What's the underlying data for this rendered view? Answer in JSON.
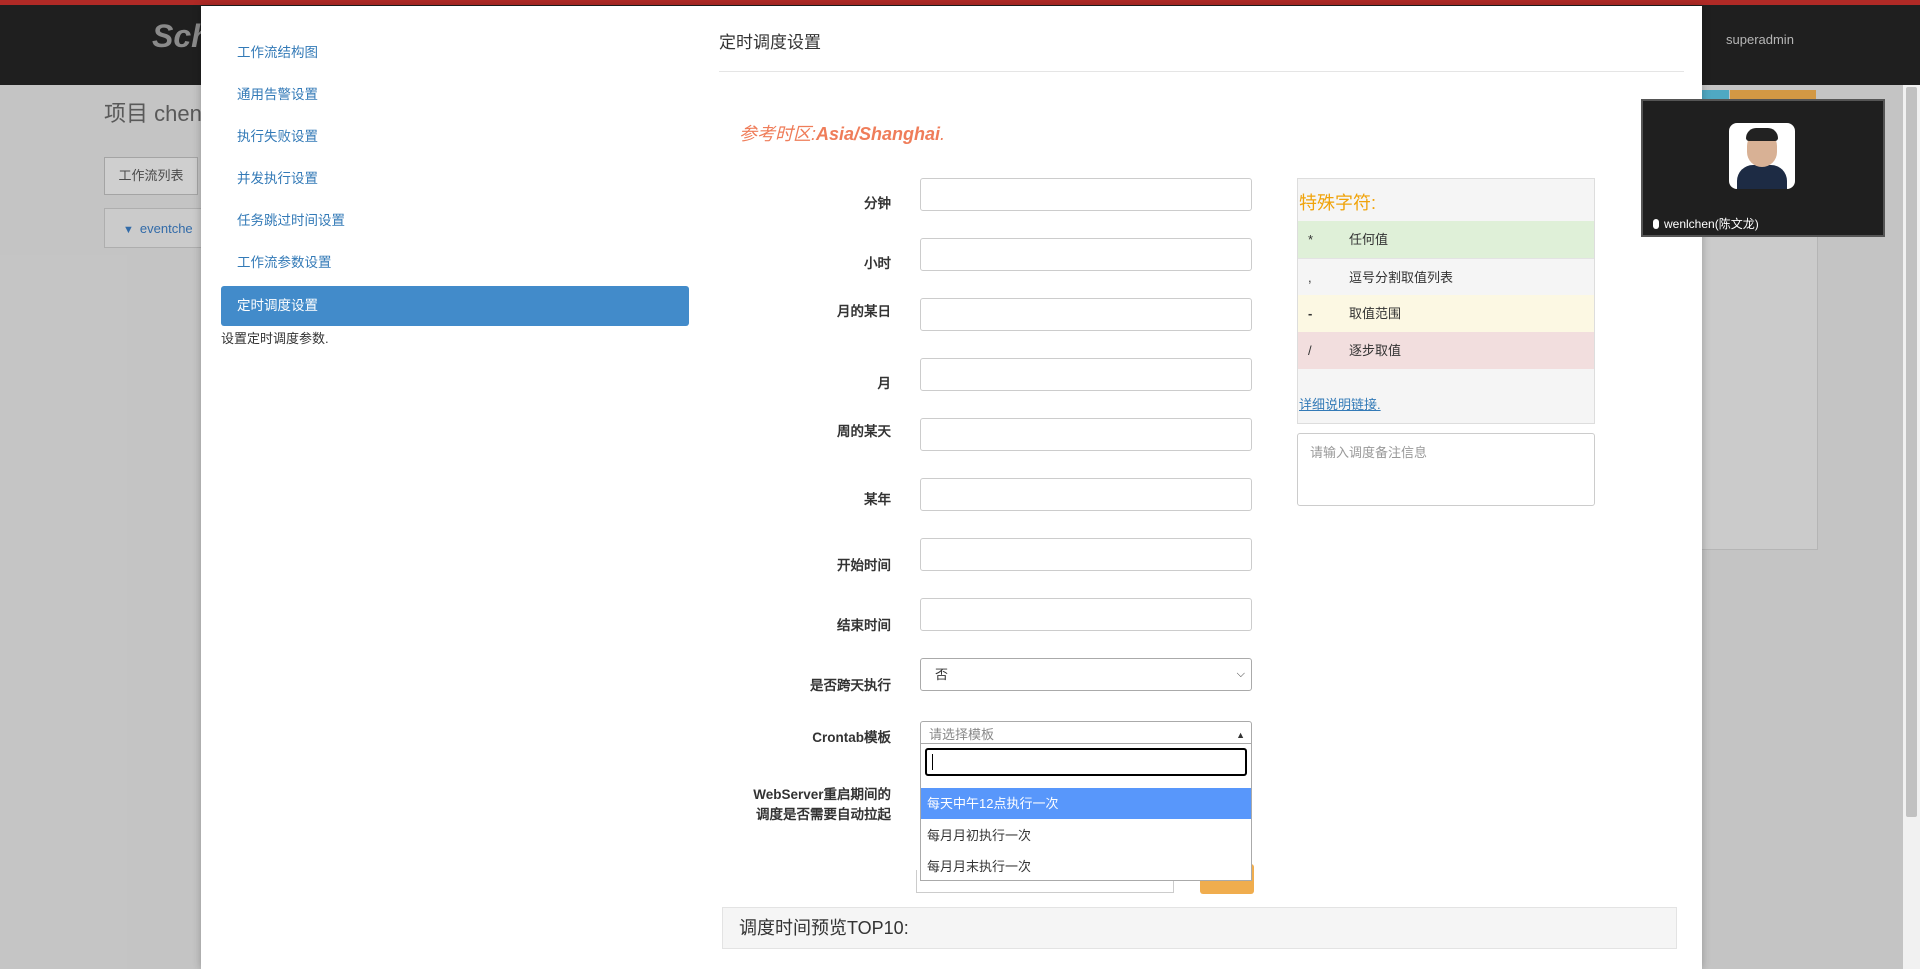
{
  "background": {
    "logo": "Sch",
    "user": "superadmin",
    "project_title": "项目 chen",
    "tab_label": "工作流列表",
    "tree_item": "eventche"
  },
  "nav": {
    "items": [
      {
        "label": "工作流结构图"
      },
      {
        "label": "通用告警设置"
      },
      {
        "label": "执行失败设置"
      },
      {
        "label": "并发执行设置"
      },
      {
        "label": "任务跳过时间设置"
      },
      {
        "label": "工作流参数设置"
      },
      {
        "label": "定时调度设置"
      }
    ],
    "active_index": 6,
    "description": "设置定时调度参数."
  },
  "content": {
    "title": "定时调度设置",
    "timezone_prefix": "参考时区:",
    "timezone_value": "Asia/Shanghai",
    "timezone_suffix": "."
  },
  "form": {
    "minute_label": "分钟",
    "hour_label": "小时",
    "day_of_month_label": "月的某日",
    "month_label": "月",
    "day_of_week_label": "周的某天",
    "year_label": "某年",
    "start_time_label": "开始时间",
    "end_time_label": "结束时间",
    "cross_day_label": "是否跨天执行",
    "cross_day_value": "否",
    "crontab_label": "Crontab模板",
    "crontab_placeholder": "请选择模板",
    "webserver_label_line1": "WebServer重启期间的",
    "webserver_label_line2": "调度是否需要自动拉起"
  },
  "crontab_dropdown": {
    "options": [
      "每天中午12点执行一次",
      "每月月初执行一次",
      "每月月末执行一次"
    ],
    "highlighted_index": 0
  },
  "special_chars": {
    "title": "特殊字符:",
    "rows": [
      {
        "symbol": "*",
        "desc": "任何值"
      },
      {
        "symbol": ",",
        "desc": "逗号分割取值列表"
      },
      {
        "symbol": "-",
        "desc": "取值范围"
      },
      {
        "symbol": "/",
        "desc": "逐步取值"
      }
    ],
    "detail_link": "详细说明链接."
  },
  "remark_placeholder": "请输入调度备注信息",
  "preview_title": "调度时间预览TOP10:",
  "video": {
    "participant": "wenlchen(陈文龙)"
  }
}
